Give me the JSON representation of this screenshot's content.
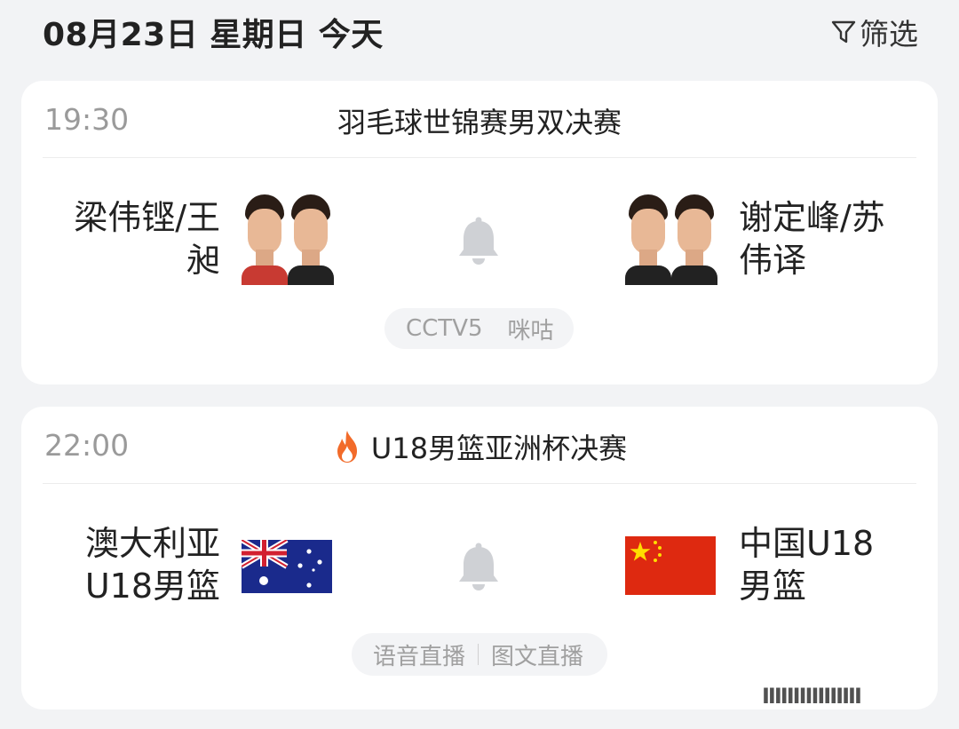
{
  "header": {
    "date_title": "08月23日 星期日 今天",
    "filter_label": "筛选"
  },
  "matches": [
    {
      "time": "19:30",
      "title": "羽毛球世锦赛男双决赛",
      "hot": false,
      "team_left": "梁伟铿/王昶",
      "team_left_line1": "梁伟铿/王",
      "team_left_line2": "昶",
      "team_right_line1": "谢定峰/苏",
      "team_right_line2": "伟译",
      "channels": [
        "CCTV5",
        "咪咕"
      ]
    },
    {
      "time": "22:00",
      "title": "U18男篮亚洲杯决赛",
      "hot": true,
      "team_left_line1": "澳大利亚",
      "team_left_line2": "U18男篮",
      "team_right_line1": "中国U18",
      "team_right_line2": "男篮",
      "channels": [
        "语音直播",
        "图文直播"
      ]
    }
  ],
  "icons": {
    "filter": "filter-icon",
    "bell": "bell-icon",
    "fire": "fire-icon",
    "flag_left": "australia-flag-icon",
    "flag_right": "china-flag-icon"
  },
  "colors": {
    "card_bg": "#ffffff",
    "page_bg": "#f2f3f5",
    "muted_text": "#9a9a9a",
    "bell": "#cfd1d5",
    "fire": "#f26b2a"
  },
  "watermark": "IIIIIIIIIIIIIIII"
}
